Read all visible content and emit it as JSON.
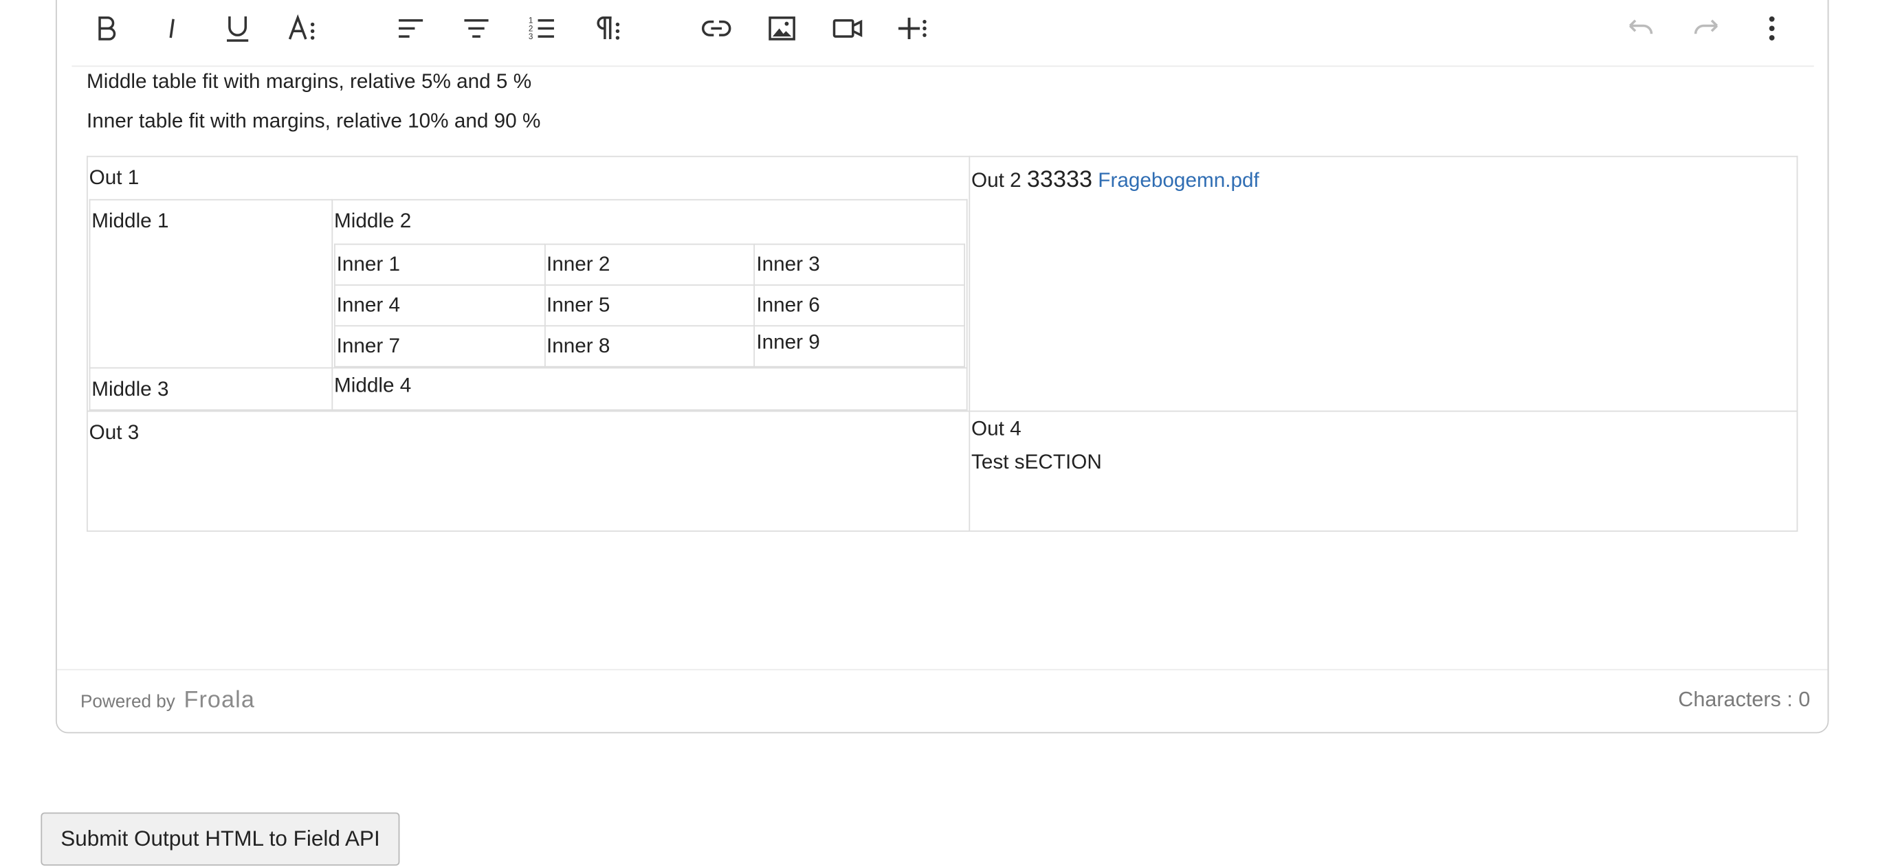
{
  "editor": {
    "toolbar": {
      "buttons": [
        {
          "name": "bold-icon",
          "label": "B"
        },
        {
          "name": "italic-icon",
          "label": "i"
        },
        {
          "name": "underline-icon",
          "label": "U"
        },
        {
          "name": "font-size-icon",
          "label": "A⁝"
        },
        {
          "name": "align-left-icon"
        },
        {
          "name": "align-center-icon"
        },
        {
          "name": "ordered-list-icon"
        },
        {
          "name": "paragraph-format-icon",
          "label": "¶⁝"
        },
        {
          "name": "link-icon"
        },
        {
          "name": "image-icon"
        },
        {
          "name": "video-icon"
        },
        {
          "name": "plus-more-icon"
        },
        {
          "name": "undo-icon"
        },
        {
          "name": "redo-icon"
        },
        {
          "name": "more-vertical-icon"
        }
      ]
    },
    "content": {
      "paragraph_1": "Middle table fit with margins, relative 5% and 5 %",
      "paragraph_2": "Inner table fit with margins, relative 10% and 90 %",
      "outer_table": {
        "out1": "Out 1",
        "out2_prefix": "Out 2",
        "out2_number": "33333",
        "out2_link": "Fragebogemn.pdf",
        "out3": "Out 3",
        "out4": "Out 4",
        "out4_section": "Test sECTION"
      },
      "middle_table": {
        "middle1": "Middle 1",
        "middle2": "Middle 2",
        "middle3": "Middle 3",
        "middle4": "Middle 4"
      },
      "inner_table": {
        "rows": [
          [
            "Inner 1",
            "Inner 2",
            "Inner 3"
          ],
          [
            "Inner 4",
            "Inner 5",
            "Inner 6"
          ],
          [
            "Inner 7",
            "Inner 8",
            "Inner 9"
          ]
        ]
      }
    },
    "footer": {
      "powered_by": "Powered by",
      "brand": "Froala",
      "characters": "Characters : 0"
    }
  },
  "submit_button": "Submit Output HTML to Field API",
  "colors": {
    "link": "#2f6db3",
    "border": "#cccccc",
    "icon": "#333333",
    "icon_disabled": "#bbbbbb"
  }
}
